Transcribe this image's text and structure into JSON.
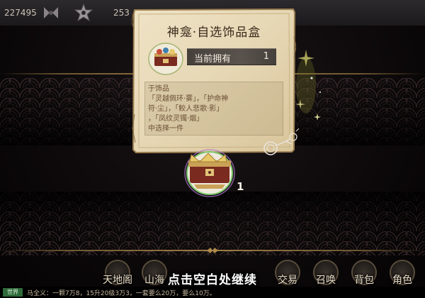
{
  "topbar": {
    "resource_a": "227495",
    "resource_b": "253"
  },
  "popup": {
    "title": "神龛·自选饰品盒",
    "owned_label": "当前拥有",
    "owned_count": "1",
    "description": [
      "于饰品",
      "「灵越佩环·雾」，「护命神",
      "符·尘」，「鲛人悲歌·影」",
      "，「凤纹灵镯·烟」",
      "中选择一件"
    ]
  },
  "board": {
    "chest_count": "1"
  },
  "bottom_nav": {
    "items": [
      {
        "label": "天地阁",
        "icon": "pavilion-icon"
      },
      {
        "label": "山海",
        "icon": "mountain-icon"
      },
      {
        "label": "交易",
        "icon": "trade-icon"
      },
      {
        "label": "召唤",
        "icon": "summon-icon"
      },
      {
        "label": "背包",
        "icon": "bag-icon"
      },
      {
        "label": "角色",
        "icon": "character-icon"
      }
    ]
  },
  "hint": "点击空白处继续",
  "chat": {
    "tag": "世界",
    "text": "马全义：一颗7万8，15升20级3万3，一套要么20万，要么10万。"
  },
  "colors": {
    "parchment": "#e9dcbf",
    "parchment_edge": "#b59a6a",
    "title_ink": "#3b2a1c",
    "owned_bar": "#4f4943",
    "gold_trim": "#a07f46"
  }
}
